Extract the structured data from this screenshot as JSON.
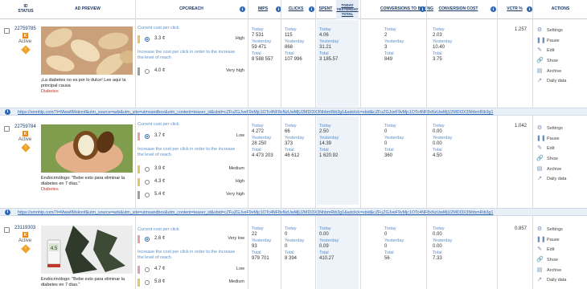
{
  "header": {
    "checkbox_col": "",
    "id_status": "ID\nSTATUS",
    "ad_preview": "AD PREVIEW",
    "cpc_reach": "CPC/REACH",
    "imps": "IMPS",
    "clicks": "CLICKS",
    "spent": "SPENT",
    "today_yesterday_total": "TODAY YESTERDAY TOTAL",
    "conversions": "CONVERSIONS TO BUYING",
    "conv_cost": "CONVERSION COST",
    "vctr": "VCTR %",
    "actions": "ACTIONS"
  },
  "labels": {
    "current_cost": "Current cost per click",
    "increase": "Increase the cost per click in order to the increase the level of reach",
    "today": "Today",
    "yesterday": "Yesterday",
    "total": "Total",
    "active": "Active"
  },
  "actions": [
    "Settings",
    "Pause",
    "Edit",
    "Show",
    "Archive",
    "Daily data"
  ],
  "colors": {
    "accent": "#2c66b0",
    "status_orange": "#e88a1a",
    "category_red": "#c0392b",
    "bid_pink": "#e8a0a8",
    "bid_yellow": "#e8c36a",
    "bid_gray": "#9aa0a6",
    "spent_bg": "#eef3fa"
  },
  "rows": [
    {
      "id": "22759785",
      "status": "Active",
      "badge": "K",
      "title": "¡La diabetes no es por lo dulce! Lee aquí la principal causa",
      "category": "Diabetes",
      "current_bid": {
        "value": "3.3 ¢",
        "level": "High",
        "color": "yellow"
      },
      "bids": [
        {
          "value": "4.0 ¢",
          "level": "Very high",
          "color": "gray"
        }
      ],
      "imps": {
        "today": "7 531",
        "yesterday": "59 471",
        "total": "8 588 557"
      },
      "clicks": {
        "today": "115",
        "yesterday": "868",
        "total": "107 996"
      },
      "spent": {
        "today": "4.06",
        "yesterday": "31.21",
        "total": "3 185.57"
      },
      "conversions": {
        "today": "2",
        "yesterday": "3",
        "total": "849"
      },
      "conv_cost": {
        "today": "2.03",
        "yesterday": "10.40",
        "total": "3.75"
      },
      "vctr": "1.257"
    },
    {
      "id": "22759784",
      "status": "Active",
      "badge": "K",
      "title": "Endocrinólogo: \"Bebe esto para eliminar la diabetes en 7 días.\"",
      "category": "Diabetes",
      "current_bid": {
        "value": "3.7 ¢",
        "level": "Low",
        "color": "pink"
      },
      "bids": [
        {
          "value": "3.9 ¢",
          "level": "Medium",
          "color": "yellow"
        },
        {
          "value": "4.3 ¢",
          "level": "High",
          "color": "yellow"
        },
        {
          "value": "5.4 ¢",
          "level": "Very high",
          "color": "gray"
        }
      ],
      "imps": {
        "today": "4 272",
        "yesterday": "28 250",
        "total": "4 473 203"
      },
      "clicks": {
        "today": "66",
        "yesterday": "373",
        "total": "46 612"
      },
      "spent": {
        "today": "2.50",
        "yesterday": "14.39",
        "total": "1 620.92"
      },
      "conversions": {
        "today": "0",
        "yesterday": "0",
        "total": "360"
      },
      "conv_cost": {
        "today": "0.00",
        "yesterday": "0.00",
        "total": "4.50"
      },
      "vctr": "1.042"
    },
    {
      "id": "23119303",
      "status": "Active",
      "badge": "K",
      "title": "Endocrinólogo: \"Bebe esto para eliminar la diabetes en 7 días.\"",
      "category": "",
      "current_bid": {
        "value": "2.6 ¢",
        "level": "Very low",
        "color": "pink"
      },
      "bids": [
        {
          "value": "4.7 ¢",
          "level": "Low",
          "color": "pink"
        },
        {
          "value": "5.8 ¢",
          "level": "Medium",
          "color": "yellow"
        }
      ],
      "imps": {
        "today": "22",
        "yesterday": "93",
        "total": "979 701"
      },
      "clicks": {
        "today": "0",
        "yesterday": "0",
        "total": "8 394"
      },
      "spent": {
        "today": "0.00",
        "yesterday": "0.09",
        "total": "410.27"
      },
      "conversions": {
        "today": "0",
        "yesterday": "0",
        "total": "56"
      },
      "conv_cost": {
        "today": "0.00",
        "yesterday": "0.00",
        "total": "7.33"
      },
      "vctr": "0.857"
    }
  ],
  "urls": [
    "https://smnhlp.com/?i=MwwllMsknnf&utm_source=ads&utm_site=utmsandbox&utm_content=teaser_id&sbid=cZFuZGJveF9vMjc1OTc4NF8xNzUwMjU2MDI3X3NhbmRib3g1&adclick=sbid&cZFuZGJveF9vMjc1OTc4NF8xNzUwMjU2MDI3X3NhbmRib3g1",
    "https://smnhlp.com/?i=MwwllMsknnf&utm_source=ads&utm_site=utmsandbox&utm_content=teaser_id&sbid=cZFuZGJveF9vMjc1OTc4NF8xNzUwMjU2MDI3X3NhbmRib3g1&adclick=sbid&cZFuZGJveF9vMjc1OTc4NF8xNzUwMjU2MDI3X3NhbmRib3g1"
  ]
}
